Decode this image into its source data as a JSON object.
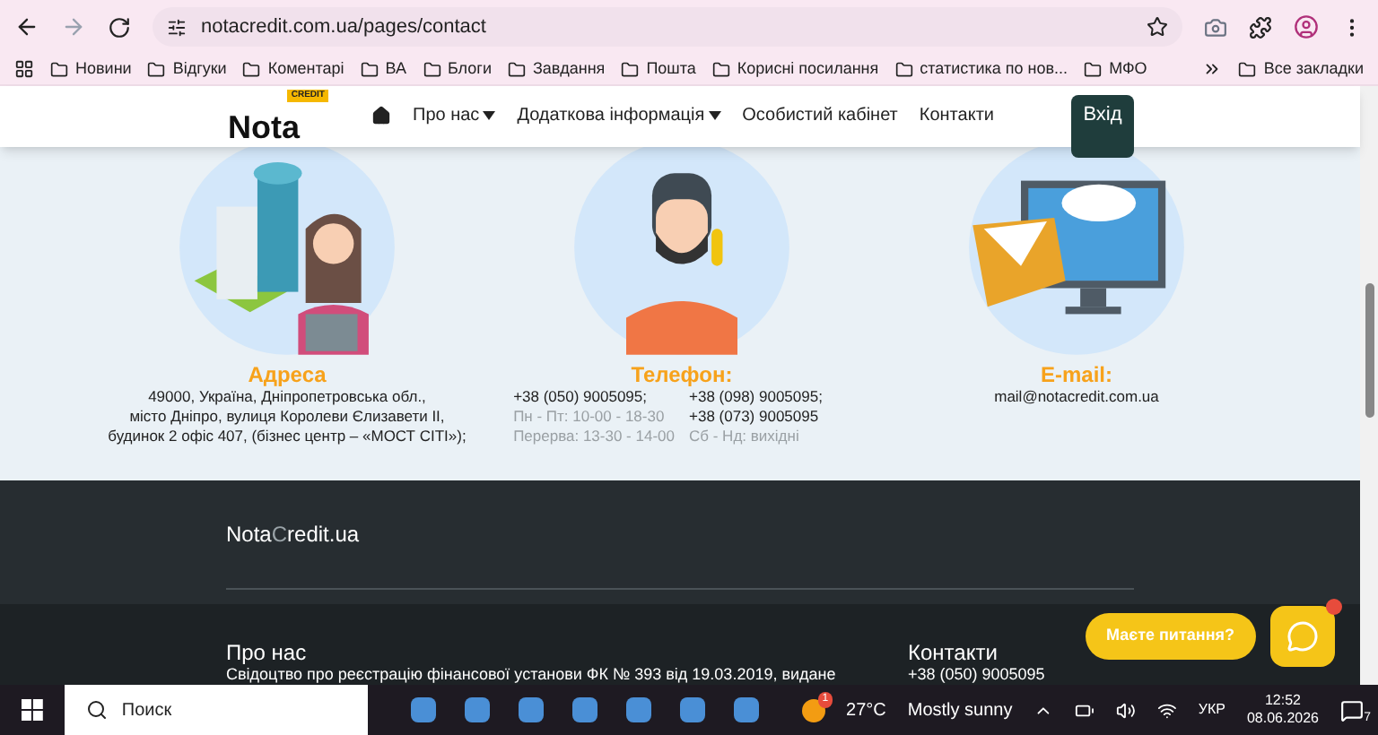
{
  "browser": {
    "url": "notacredit.com.ua/pages/contact",
    "bookmarks": [
      "Новини",
      "Відгуки",
      "Коментарі",
      "ВА",
      "Блоги",
      "Завдання",
      "Пошта",
      "Корисні посилання",
      "статистика по нов...",
      "МФО"
    ],
    "all_bookmarks": "Все закладки"
  },
  "header": {
    "logo": {
      "badge": "CREDIT",
      "text": "Nota"
    },
    "nav": [
      {
        "label": "Про нас",
        "dropdown": true
      },
      {
        "label": "Додаткова інформація",
        "dropdown": true
      },
      {
        "label": "Особистий кабінет",
        "dropdown": false
      },
      {
        "label": "Контакти",
        "dropdown": false
      }
    ],
    "login": "Вхід"
  },
  "contacts": [
    {
      "kind": "address",
      "title": "Адреса",
      "lines": [
        "49000, Україна, Дніпропетровська обл.,",
        "місто Дніпро, вулиця Королеви Єлизавети II,",
        "будинок 2 офіс 407, (бізнес центр – «МОСТ CITI»);"
      ]
    },
    {
      "kind": "phone",
      "title": "Телефон:",
      "cells": [
        {
          "text": "+38 (050) 9005095;",
          "muted": false
        },
        {
          "text": "+38 (098) 9005095;",
          "muted": false
        },
        {
          "text": "Пн - Пт: 10-00 - 18-30",
          "muted": true
        },
        {
          "text": "+38 (073) 9005095",
          "muted": false
        },
        {
          "text": "Перерва: 13-30 - 14-00",
          "muted": true
        },
        {
          "text": "Сб - Нд: вихідні",
          "muted": true
        }
      ]
    },
    {
      "kind": "email",
      "title": "E-mail:",
      "lines": [
        "mail@notacredit.com.ua"
      ]
    }
  ],
  "footer": {
    "brand": {
      "prefix": "Nota",
      "accent": "C",
      "suffix": "redit.ua"
    },
    "about": {
      "title": "Про нас",
      "text": "Свідоцтво про реєстрацію фінансової установи ФК № 393 від 19.03.2019, видане"
    },
    "contacts": {
      "title": "Контакти",
      "phone": "+38 (050) 9005095"
    }
  },
  "chat": {
    "prompt": "Маєте питання?",
    "unread": true
  },
  "taskbar": {
    "search": "Поиск",
    "weather_badge": "1",
    "temperature": "27°C",
    "weather": "Mostly sunny",
    "language": "УКР",
    "time": "12:52",
    "date": "08.06.2026",
    "notifications": "7"
  }
}
